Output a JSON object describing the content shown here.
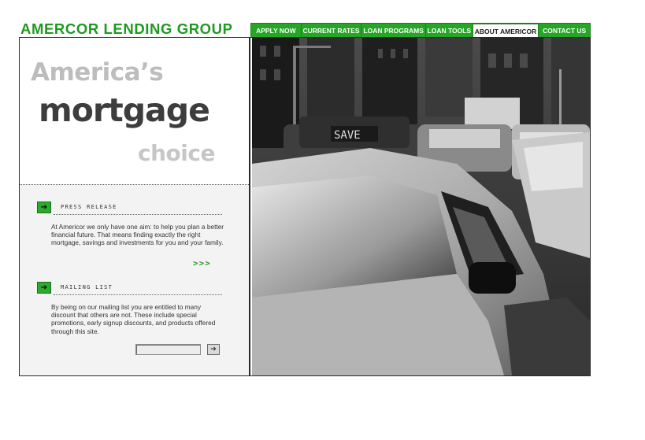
{
  "header": {
    "brand": "AMERCOR LENDING GROUP",
    "nav": [
      {
        "label": "APPLY NOW",
        "active": false
      },
      {
        "label": "CURRENT RATES",
        "active": false
      },
      {
        "label": "LOAN PROGRAMS",
        "active": false
      },
      {
        "label": "LOAN TOOLS",
        "active": false
      },
      {
        "label": "ABOUT AMERICOR",
        "active": true
      },
      {
        "label": "CONTACT US",
        "active": false
      }
    ]
  },
  "tagline": {
    "line1": "America’s",
    "line2": "mortgage",
    "line3": "choice"
  },
  "press_release": {
    "title": "PRESS RELEASE",
    "text": "At Americor we only have one aim: to help you plan a better financial future. That means finding exactly the right mortgage, savings and investments for you and your family.",
    "more": ">>>",
    "icon": "arrow-right-icon"
  },
  "mailing_list": {
    "title": "MAILING LIST",
    "text": "By being on our mailing list you are entitled to many discount that others are not. These include special promotions, early signup discounts, and products offered through this site.",
    "input_value": "",
    "submit_icon": "arrow-right-icon",
    "icon": "arrow-right-icon"
  },
  "colors": {
    "brand_green": "#1e9a1e",
    "nav_green": "#26a626",
    "panel_gray": "#f3f3f3"
  }
}
